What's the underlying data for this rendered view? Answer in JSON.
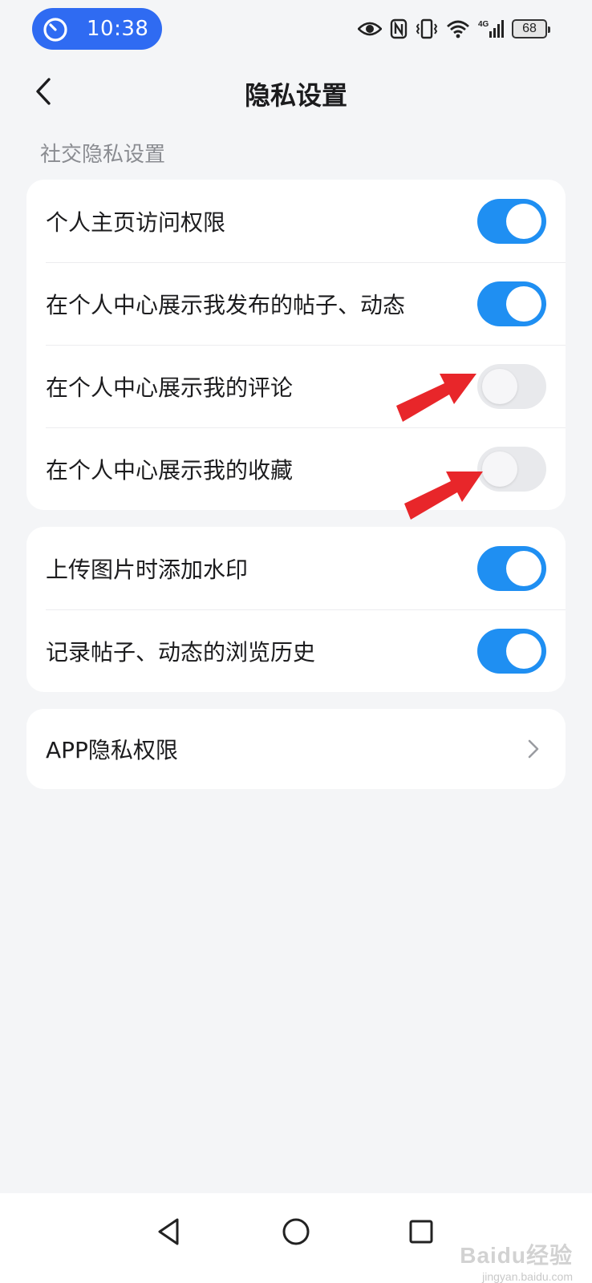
{
  "status_bar": {
    "time": "10:38",
    "battery": "68",
    "icons": [
      "timer-icon",
      "eye-icon",
      "nfc-icon",
      "vibrate-icon",
      "wifi-icon",
      "signal-4g-icon",
      "battery-icon"
    ]
  },
  "header": {
    "title": "隐私设置",
    "back_icon": "chevron-left-icon"
  },
  "section": {
    "label": "社交隐私设置"
  },
  "card1": {
    "rows": [
      {
        "label": "个人主页访问权限",
        "toggle": true
      },
      {
        "label": "在个人中心展示我发布的帖子、动态",
        "toggle": true
      },
      {
        "label": "在个人中心展示我的评论",
        "toggle": false
      },
      {
        "label": "在个人中心展示我的收藏",
        "toggle": false
      }
    ]
  },
  "card2": {
    "rows": [
      {
        "label": "上传图片时添加水印",
        "toggle": true
      },
      {
        "label": "记录帖子、动态的浏览历史",
        "toggle": true
      }
    ]
  },
  "card3": {
    "rows": [
      {
        "label": "APP隐私权限",
        "icon": "chevron-right-icon"
      }
    ]
  },
  "colors": {
    "accent": "#1f8ff2",
    "time_pill": "#2f6bf2",
    "annotation_arrow": "#e8262a",
    "background": "#f4f5f7"
  },
  "system_nav": {
    "icons": [
      "back-triangle-icon",
      "home-circle-icon",
      "recents-square-icon"
    ]
  },
  "watermark": {
    "logo": "Baidu经验",
    "url": "jingyan.baidu.com"
  }
}
